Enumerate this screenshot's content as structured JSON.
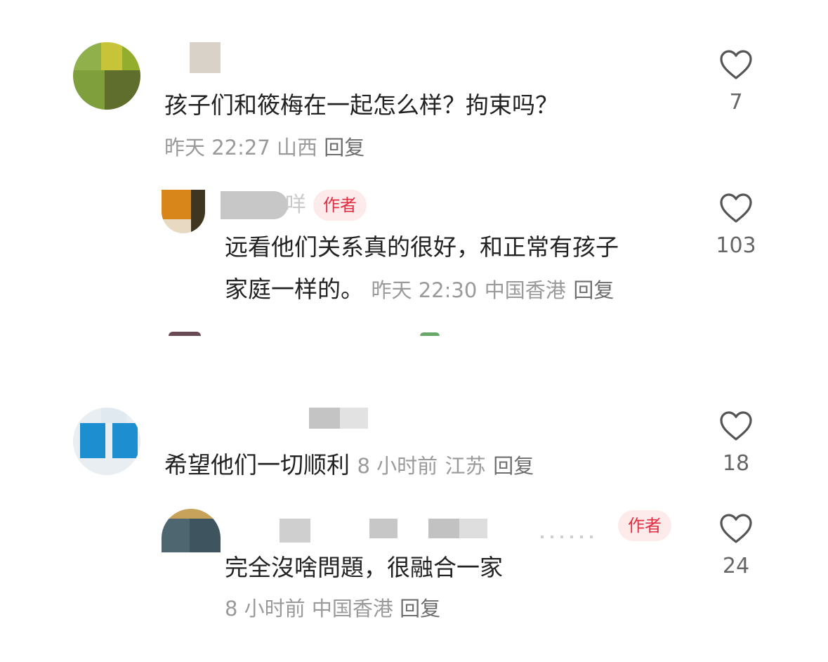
{
  "thread1": {
    "comment": {
      "text": "孩子们和筱梅在一起怎么样？拘束吗？",
      "time": "昨天 22:27",
      "location": "山西",
      "reply_label": "回复",
      "likes": "7"
    },
    "reply": {
      "name_partial": "咩",
      "badge": "作者",
      "text_line1": "远看他们关系真的很好，和正常有孩子",
      "text_line2": "家庭一样的。",
      "time": "昨天 22:30",
      "location": "中国香港",
      "reply_label": "回复",
      "likes": "103"
    }
  },
  "thread2": {
    "comment": {
      "text": "希望他们一切顺利",
      "time": "8 小时前",
      "location": "江苏",
      "reply_label": "回复",
      "likes": "18"
    },
    "reply": {
      "badge": "作者",
      "text": "完全沒啥問題，很融合一家",
      "time": "8 小时前",
      "location": "中国香港",
      "reply_label": "回复",
      "likes": "24"
    }
  },
  "icons": {
    "like": "heart-outline-icon"
  },
  "colors": {
    "badge_text": "#e02e43",
    "badge_bg": "#fdeaea",
    "meta": "#9a9a9a"
  }
}
